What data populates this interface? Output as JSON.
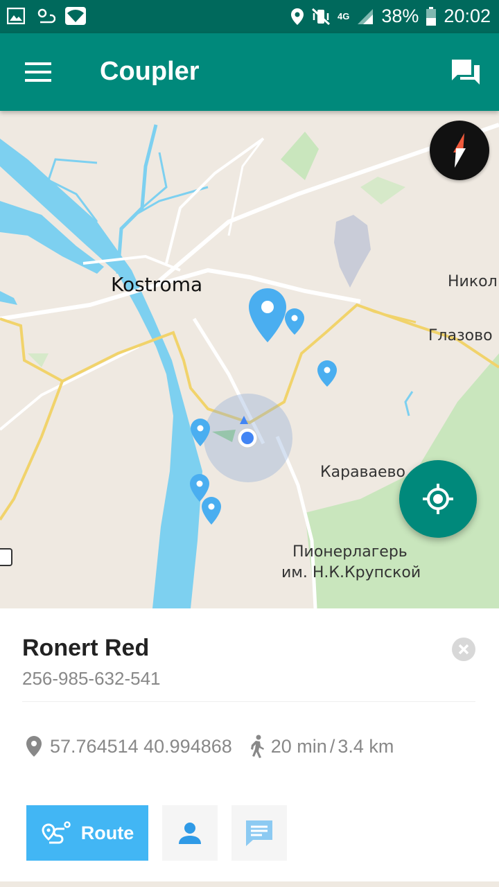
{
  "status_bar": {
    "battery": "38%",
    "time": "20:02",
    "network": "4G",
    "left_icons": [
      "image-icon",
      "weather-icon",
      "wifi-icon"
    ],
    "right_icons": [
      "location-icon",
      "vibrate-icon",
      "signal-icon",
      "battery-icon"
    ]
  },
  "app_bar": {
    "title": "Coupler",
    "menu_icon": "hamburger-menu-icon",
    "chat_icon": "chat-bubbles-icon"
  },
  "map": {
    "labels": {
      "kostroma": "Kostroma",
      "nikol": "Никол",
      "glazovo": "Глазово",
      "karavaevo": "Караваево",
      "pioneer_line1": "Пионерлагерь",
      "pioneer_line2": "им. Н.К.Крупской"
    },
    "compass_icon": "compass-icon",
    "locate_icon": "my-location-icon"
  },
  "contact": {
    "name": "Ronert Red",
    "phone": "256-985-632-541",
    "coordinates": "57.764514 40.994868",
    "walk_time": "20 min",
    "distance": "3.4 km",
    "separator": "/"
  },
  "actions": {
    "route_label": "Route"
  },
  "colors": {
    "status_bar": "#00695c",
    "app_bar": "#00897b",
    "accent": "#42b6f4",
    "water": "#7dd0f0",
    "land": "#efe9e1"
  }
}
